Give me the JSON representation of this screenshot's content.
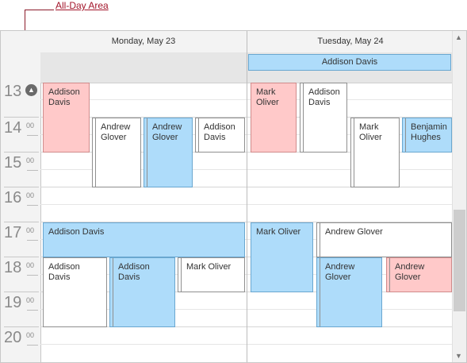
{
  "callout": {
    "label": "All-Day Area"
  },
  "days": [
    {
      "header": "Monday, May 23"
    },
    {
      "header": "Tuesday, May 24"
    }
  ],
  "allday": [
    {
      "day": 2,
      "title": "Addison Davis",
      "color": "#aedcfa"
    }
  ],
  "hours": [
    {
      "h": "13",
      "m": ""
    },
    {
      "h": "14",
      "m": "00"
    },
    {
      "h": "15",
      "m": "00"
    },
    {
      "h": "16",
      "m": "00"
    },
    {
      "h": "17",
      "m": "00"
    },
    {
      "h": "18",
      "m": "00"
    },
    {
      "h": "19",
      "m": "00"
    },
    {
      "h": "20",
      "m": "00"
    }
  ],
  "appointments": [
    {
      "title": "Addison Davis",
      "color": "pink"
    },
    {
      "title": "Andrew Glover",
      "color": "white"
    },
    {
      "title": "Andrew Glover",
      "color": "blue"
    },
    {
      "title": "Addison Davis",
      "color": "white"
    },
    {
      "title": "Addison Davis",
      "color": "blue"
    },
    {
      "title": "Addison Davis",
      "color": "white"
    },
    {
      "title": "Addison Davis",
      "color": "blue"
    },
    {
      "title": "Mark Oliver",
      "color": "white"
    },
    {
      "title": "Mark Oliver",
      "color": "pink"
    },
    {
      "title": "Addison Davis",
      "color": "white"
    },
    {
      "title": "Mark Oliver",
      "color": "white"
    },
    {
      "title": "Benjamin Hughes",
      "color": "blue"
    },
    {
      "title": "Mark Oliver",
      "color": "blue"
    },
    {
      "title": "Andrew Glover",
      "color": "white"
    },
    {
      "title": "Andrew Glover",
      "color": "blue"
    },
    {
      "title": "Andrew Glover",
      "color": "pink"
    }
  ],
  "icons": {
    "collapse": "chevron-up-icon",
    "scroll_up": "scroll-up-arrow-icon",
    "scroll_down": "scroll-down-arrow-icon"
  }
}
